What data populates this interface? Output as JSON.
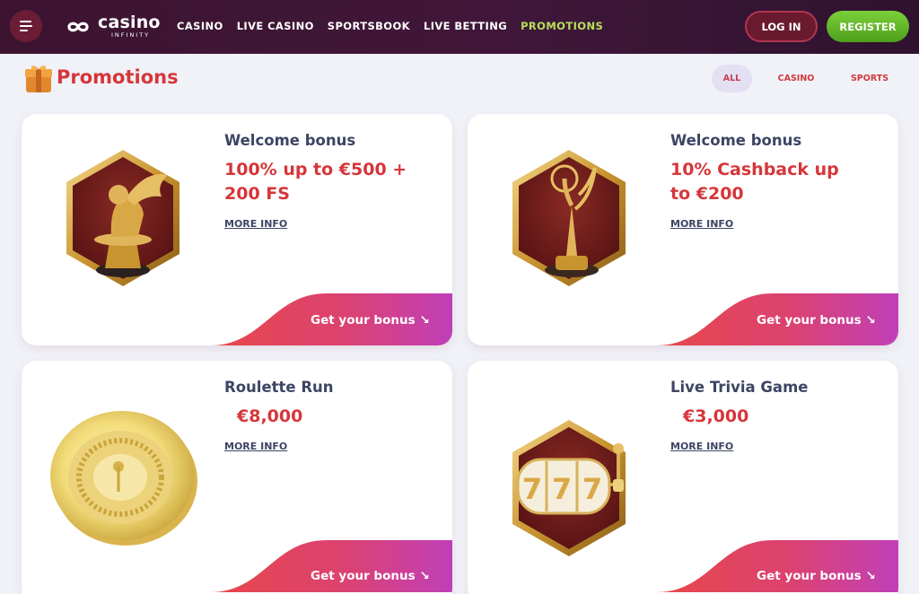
{
  "header": {
    "logo": {
      "word": "casino",
      "sub": "INFINITY"
    },
    "nav": [
      "CASINO",
      "LIVE CASINO",
      "SPORTSBOOK",
      "LIVE BETTING",
      "PROMOTIONS"
    ],
    "active_nav": "PROMOTIONS",
    "login_label": "LOG IN",
    "register_label": "REGISTER"
  },
  "page": {
    "title": "Promotions",
    "filters": [
      "ALL",
      "CASINO",
      "SPORTS"
    ],
    "active_filter": "ALL"
  },
  "promotions": [
    {
      "title": "Welcome bonus",
      "offer": "100% up to €500 + 200 FS",
      "more": "MORE INFO",
      "cta": "Get your bonus ↘",
      "image": "golden-lion-trophy"
    },
    {
      "title": "Welcome bonus",
      "offer": "10% Cashback up to €200",
      "more": "MORE INFO",
      "cta": "Get your bonus ↘",
      "image": "golden-figure-trophy"
    },
    {
      "title": "Roulette Run",
      "offer": "€8,000",
      "more": "MORE INFO",
      "cta": "Get your bonus ↘",
      "image": "golden-roulette-wheel"
    },
    {
      "title": "Live Trivia Game",
      "offer": "€3,000",
      "more": "MORE INFO",
      "cta": "Get your bonus ↘",
      "image": "slot-machine-777"
    }
  ],
  "colors": {
    "header_bg": "#3c1430",
    "accent_red": "#d6363a",
    "nav_active": "#b7e05a",
    "register_green": "#5cb82a",
    "cta_gradient_start": "#e8474a",
    "cta_gradient_end": "#c03fb8"
  }
}
